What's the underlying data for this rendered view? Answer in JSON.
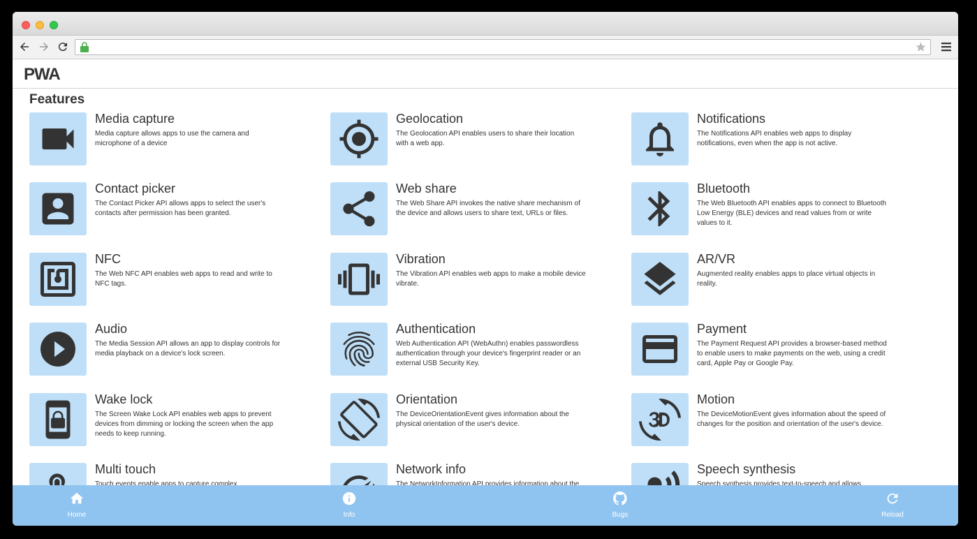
{
  "app": {
    "brand": "PWA"
  },
  "section": {
    "title": "Features"
  },
  "features": [
    {
      "title": "Media capture",
      "desc": "Media capture allows apps to use the camera and microphone of a device",
      "icon": "videocam-icon"
    },
    {
      "title": "Geolocation",
      "desc": "The Geolocation API enables users to share their location with a web app.",
      "icon": "gps-icon"
    },
    {
      "title": "Notifications",
      "desc": "The Notifications API enables web apps to display notifications, even when the app is not active.",
      "icon": "bell-icon"
    },
    {
      "title": "Contact picker",
      "desc": "The Contact Picker API allows apps to select the user's contacts after permission has been granted.",
      "icon": "contact-icon"
    },
    {
      "title": "Web share",
      "desc": "The Web Share API invokes the native share mechanism of the device and allows users to share text, URLs or files.",
      "icon": "share-icon"
    },
    {
      "title": "Bluetooth",
      "desc": "The Web Bluetooth API enables apps to connect to Bluetooth Low Energy (BLE) devices and read values from or write values to it.",
      "icon": "bluetooth-icon"
    },
    {
      "title": "NFC",
      "desc": "The Web NFC API enables web apps to read and write to NFC tags.",
      "icon": "nfc-icon"
    },
    {
      "title": "Vibration",
      "desc": "The Vibration API enables web apps to make a mobile device vibrate.",
      "icon": "vibration-icon"
    },
    {
      "title": "AR/VR",
      "desc": "Augmented reality enables apps to place virtual objects in reality.",
      "icon": "layers-icon"
    },
    {
      "title": "Audio",
      "desc": "The Media Session API allows an app to display controls for media playback on a device's lock screen.",
      "icon": "play-icon"
    },
    {
      "title": "Authentication",
      "desc": "Web Authentication API (WebAuthn) enables passwordless authentication through your device's fingerprint reader or an external USB Security Key.",
      "icon": "fingerprint-icon"
    },
    {
      "title": "Payment",
      "desc": "The Payment Request API provides a browser-based method to enable users to make payments on the web, using a credit card, Apple Pay or Google Pay.",
      "icon": "credit-card-icon"
    },
    {
      "title": "Wake lock",
      "desc": "The Screen Wake Lock API enables web apps to prevent devices from dimming or locking the screen when the app needs to keep running.",
      "icon": "phone-lock-icon"
    },
    {
      "title": "Orientation",
      "desc": "The DeviceOrientationEvent gives information about the physical orientation of the user's device.",
      "icon": "screen-rotation-icon"
    },
    {
      "title": "Motion",
      "desc": "The DeviceMotionEvent gives information about the speed of changes for the position and orientation of the user's device.",
      "icon": "3d-rotation-icon"
    },
    {
      "title": "Multi touch",
      "desc": "Touch events enable apps to capture complex",
      "icon": "touch-icon"
    },
    {
      "title": "Network info",
      "desc": "The NetworkInformation API provides information about the",
      "icon": "network-speed-icon"
    },
    {
      "title": "Speech synthesis",
      "desc": "Speech synthesis provides text-to-speech and allows",
      "icon": "speech-icon"
    }
  ],
  "bottom_nav": [
    {
      "label": "Home",
      "icon": "home-icon"
    },
    {
      "label": "Info",
      "icon": "info-icon"
    },
    {
      "label": "Bugs",
      "icon": "github-icon"
    },
    {
      "label": "Reload",
      "icon": "reload-icon"
    }
  ]
}
